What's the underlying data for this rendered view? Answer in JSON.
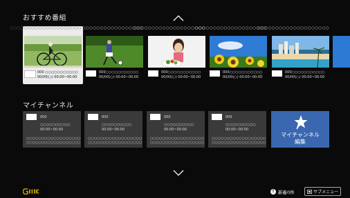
{
  "recommended": {
    "title": "おすすめ番組",
    "cards": [
      {
        "circles": "○○○○○○○○○○○○○○○○○○○○",
        "channel": "000 ○○○○○○○○○○○",
        "datetime": "00/00(○) 00:00~00:00",
        "image": "cyclist",
        "focused": true
      },
      {
        "circles": "○○○○○○○○○○○○○○○○○○○○",
        "channel": "000○○○○○○○○○○○",
        "datetime": "00/00(○) 00:00~00:00",
        "image": "soccer",
        "focused": false
      },
      {
        "circles": "○○○○○○○○○○○○○○○○○○○○",
        "channel": "000○○○○○○○○○○○",
        "datetime": "00/00(○) 00:00~00:00",
        "image": "woman-salad",
        "focused": false
      },
      {
        "circles": "○○○○○○○○○○○○○○○○○○○○",
        "channel": "000○○○○○○○○○○○",
        "datetime": "00/00(○) 00:00~00:00",
        "image": "sunflowers",
        "focused": false
      },
      {
        "circles": "○○○○○○○○○○○○○○○○○○○○",
        "channel": "000○○○○○○○○○○○",
        "datetime": "00/00(○) 00:00~00:00",
        "image": "beach-city",
        "focused": false
      }
    ]
  },
  "mychannel": {
    "title": "マイチャンネル",
    "cards": [
      {
        "num": "000",
        "program": "○○○○○○○○○○",
        "time": "00:00~00:00",
        "desc1": "○○○○○○○○○○○○○○○○○○",
        "desc2": "○○○○○○○○○○○○○○○○○○"
      },
      {
        "num": "000",
        "program": "○○○○○○○○○○",
        "time": "00:00~00:00",
        "desc1": "○○○○○○○○○○○○○○○○○○",
        "desc2": "○○○○○○○○○○○○○○○○○○"
      },
      {
        "num": "000",
        "program": "○○○○○○○○○○",
        "time": "00:00~00:00",
        "desc1": "○○○○○○○○○○○○○○○○○○",
        "desc2": "○○○○○○○○○○○○○○○○○○"
      },
      {
        "num": "000",
        "program": "○○○○○○○○○○",
        "time": "00:00~00:00",
        "desc1": "○○○○○○○○○○○○○○○○○○",
        "desc2": "○○○○○○○○○○○○○○○○○○"
      }
    ],
    "edit_label_line1": "マイチャンネル",
    "edit_label_line2": "編集"
  },
  "footer": {
    "news_label": "新着0件",
    "submenu_label": "サブメニュー"
  },
  "icons": {
    "up": "chevron-up-icon",
    "down": "chevron-down-icon",
    "star": "star-icon",
    "info": "info-icon"
  },
  "colors": {
    "background": "#0a0a0a",
    "card": "#3a3a3a",
    "accent": "#3a67b0",
    "focus": "#ececec",
    "logo": "#c8a000"
  }
}
